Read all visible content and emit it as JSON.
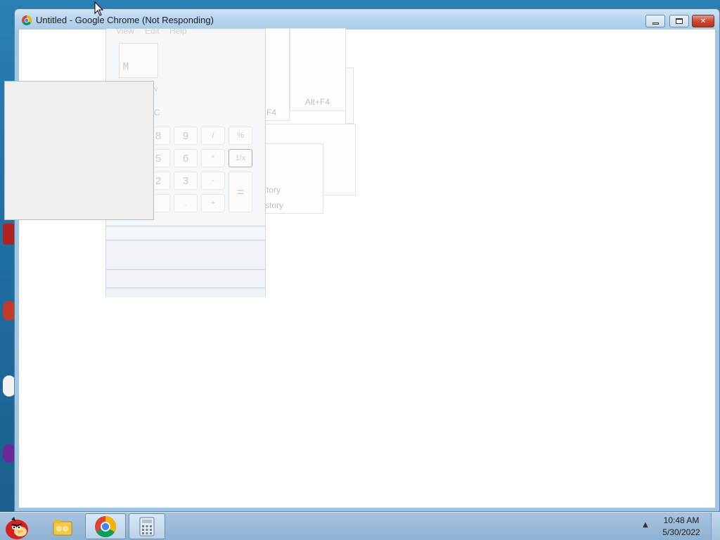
{
  "window": {
    "title": "Untitled - Google Chrome (Not Responding)",
    "minimize_glyph": "",
    "maximize_glyph": "",
    "close_glyph": "✕"
  },
  "ghost_calculator": {
    "menu": [
      "View",
      "Edit",
      "Help"
    ],
    "display_memory": "M",
    "keys": [
      "8",
      "9",
      "/",
      "%",
      "5",
      "6",
      "*",
      "1/x",
      "2",
      "3",
      "-",
      "=",
      ".",
      "+"
    ],
    "partial_labels": [
      "v",
      "C"
    ]
  },
  "ghost_panels": {
    "shortcut_a": "F4",
    "shortcut_b": "Alt+F4",
    "history_a": "tory",
    "history_b": "story"
  },
  "taskbar": {
    "clock_time": "10:48 AM",
    "clock_date": "5/30/2022",
    "tray_arrow": "▲",
    "items": [
      "angry-birds",
      "folder",
      "chrome",
      "calculator"
    ]
  },
  "colors": {
    "titlebar": "#b8d5ee",
    "close_button": "#c94a33",
    "taskbar": "#9bbbd9"
  }
}
